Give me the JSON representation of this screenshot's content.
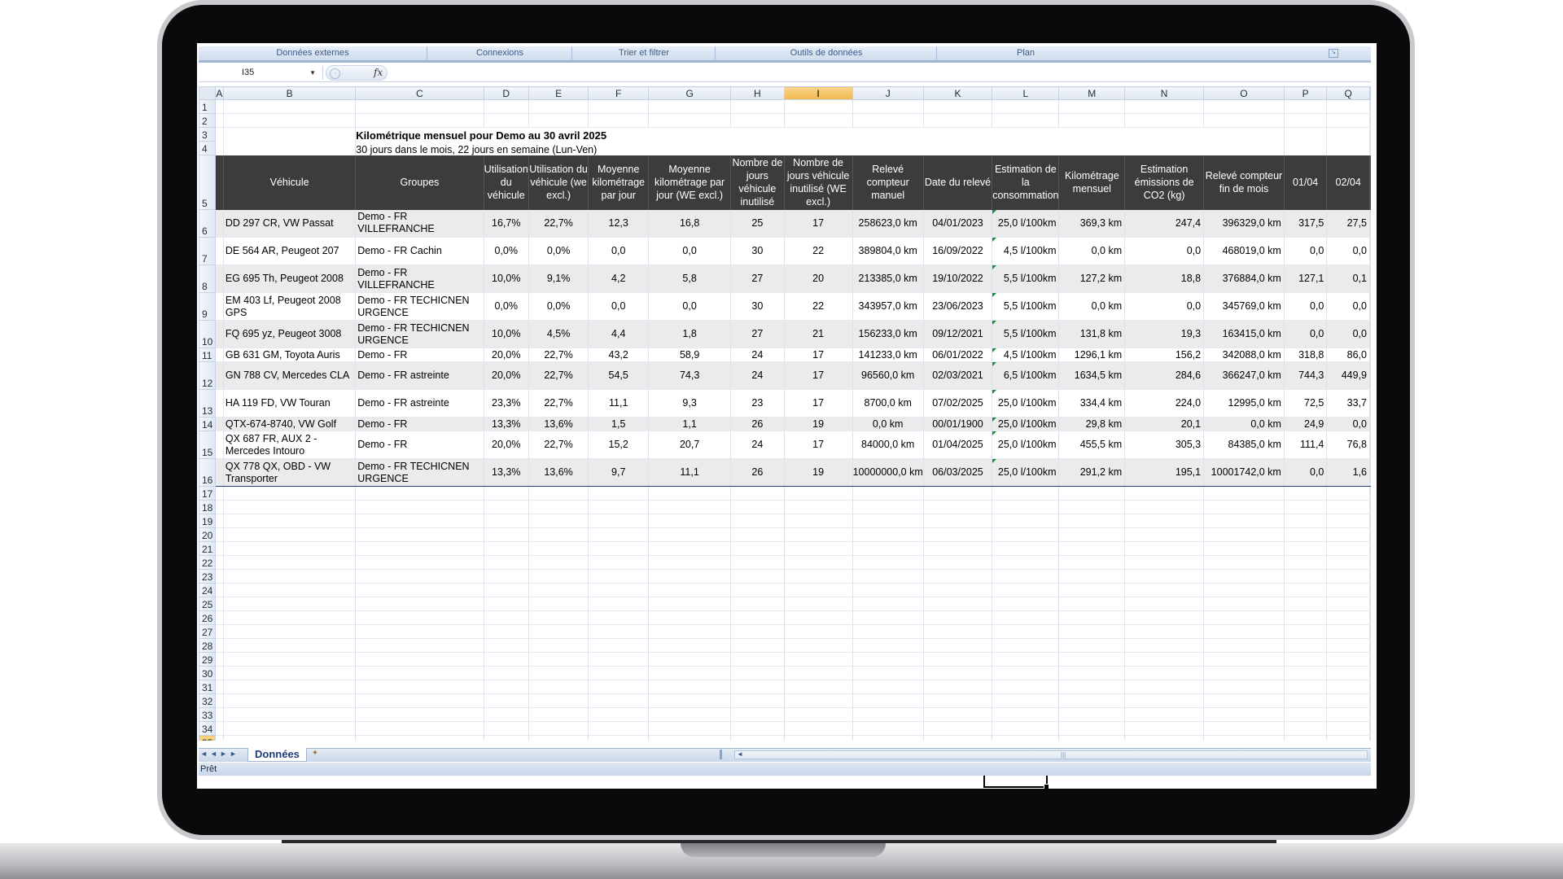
{
  "ribbon": {
    "groups": [
      "Données externes",
      "Connexions",
      "Trier et filtrer",
      "Outils de données",
      "Plan"
    ]
  },
  "formula_bar": {
    "name_box": "I35",
    "fx": "fx",
    "formula": ""
  },
  "columns": [
    "A",
    "B",
    "C",
    "D",
    "E",
    "F",
    "G",
    "H",
    "I",
    "J",
    "K",
    "L",
    "M",
    "N",
    "O",
    "P",
    "Q"
  ],
  "selected_column": "I",
  "selected_cell": "I35",
  "sheet": {
    "title": "Kilométrique mensuel pour Demo au 30 avril 2025",
    "subtitle": "30 jours dans le mois, 22 jours en semaine (Lun-Ven)",
    "headers": [
      "Véhicule",
      "Groupes",
      "Utilisation du véhicule",
      "Utilisation du véhicule (we excl.)",
      "Moyenne kilométrage par jour",
      "Moyenne kilométrage par jour (WE excl.)",
      "Nombre de jours véhicule inutilisé",
      "Nombre de jours véhicule inutilisé (WE excl.)",
      "Relevé compteur manuel",
      "Date du relevé",
      "Estimation de la consommation",
      "Kilométrage mensuel",
      "Estimation émissions de CO2 (kg)",
      "Relevé compteur fin de mois",
      "01/04",
      "02/04"
    ],
    "rows": [
      [
        "DD 297 CR, VW Passat",
        "Demo - FR VILLEFRANCHE",
        "16,7%",
        "22,7%",
        "12,3",
        "16,8",
        "25",
        "17",
        "258623,0 km",
        "04/01/2023",
        "25,0 l/100km",
        "369,3 km",
        "247,4",
        "396329,0 km",
        "317,5",
        "27,5"
      ],
      [
        "DE 564 AR, Peugeot 207",
        "Demo - FR Cachin",
        "0,0%",
        "0,0%",
        "0,0",
        "0,0",
        "30",
        "22",
        "389804,0 km",
        "16/09/2022",
        "4,5 l/100km",
        "0,0 km",
        "0,0",
        "468019,0 km",
        "0,0",
        "0,0"
      ],
      [
        "EG 695 Th, Peugeot 2008",
        "Demo - FR VILLEFRANCHE",
        "10,0%",
        "9,1%",
        "4,2",
        "5,8",
        "27",
        "20",
        "213385,0 km",
        "19/10/2022",
        "5,5 l/100km",
        "127,2 km",
        "18,8",
        "376884,0 km",
        "127,1",
        "0,1"
      ],
      [
        "EM 403 Lf, Peugeot 2008 GPS",
        "Demo - FR TECHICNEN URGENCE",
        "0,0%",
        "0,0%",
        "0,0",
        "0,0",
        "30",
        "22",
        "343957,0 km",
        "23/06/2023",
        "5,5 l/100km",
        "0,0 km",
        "0,0",
        "345769,0 km",
        "0,0",
        "0,0"
      ],
      [
        "FQ 695 yz, Peugeot 3008",
        "Demo - FR TECHICNEN URGENCE",
        "10,0%",
        "4,5%",
        "4,4",
        "1,8",
        "27",
        "21",
        "156233,0 km",
        "09/12/2021",
        "5,5 l/100km",
        "131,8 km",
        "19,3",
        "163415,0 km",
        "0,0",
        "0,0"
      ],
      [
        "GB 631 GM, Toyota Auris",
        "Demo - FR",
        "20,0%",
        "22,7%",
        "43,2",
        "58,9",
        "24",
        "17",
        "141233,0 km",
        "06/01/2022",
        "4,5 l/100km",
        "1296,1 km",
        "156,2",
        "342088,0 km",
        "318,8",
        "86,0"
      ],
      [
        "GN 788 CV, Mercedes CLA",
        "Demo - FR astreinte",
        "20,0%",
        "22,7%",
        "54,5",
        "74,3",
        "24",
        "17",
        "96560,0 km",
        "02/03/2021",
        "6,5 l/100km",
        "1634,5 km",
        "284,6",
        "366247,0 km",
        "744,3",
        "449,9"
      ],
      [
        "HA 119 FD, VW Touran",
        "Demo - FR astreinte",
        "23,3%",
        "22,7%",
        "11,1",
        "9,3",
        "23",
        "17",
        "8700,0 km",
        "07/02/2025",
        "25,0 l/100km",
        "334,4 km",
        "224,0",
        "12995,0 km",
        "72,5",
        "33,7"
      ],
      [
        "QTX-674-8740, VW Golf",
        "Demo - FR",
        "13,3%",
        "13,6%",
        "1,5",
        "1,1",
        "26",
        "19",
        "0,0 km",
        "00/01/1900",
        "25,0 l/100km",
        "29,8 km",
        "20,1",
        "0,0 km",
        "24,9",
        "0,0"
      ],
      [
        "QX 687 FR, AUX 2 - Mercedes Intouro",
        "Demo - FR",
        "20,0%",
        "22,7%",
        "15,2",
        "20,7",
        "24",
        "17",
        "84000,0 km",
        "01/04/2025",
        "25,0 l/100km",
        "455,5 km",
        "305,3",
        "84385,0 km",
        "111,4",
        "76,8"
      ],
      [
        "QX 778 QX, OBD - VW Transporter",
        "Demo - FR TECHICNEN URGENCE",
        "13,3%",
        "13,6%",
        "9,7",
        "11,1",
        "26",
        "19",
        "10000000,0 km",
        "06/03/2025",
        "25,0 l/100km",
        "291,2 km",
        "195,1",
        "10001742,0 km",
        "0,0",
        "1,6"
      ]
    ]
  },
  "sheet_tabs": [
    "Données"
  ],
  "status": "Prêt",
  "colors": {
    "header_bg": "#3c3c3c",
    "row_alt": "#ebebeb",
    "selection": "#f0b74c",
    "ribbon_text": "#3b5a85"
  }
}
